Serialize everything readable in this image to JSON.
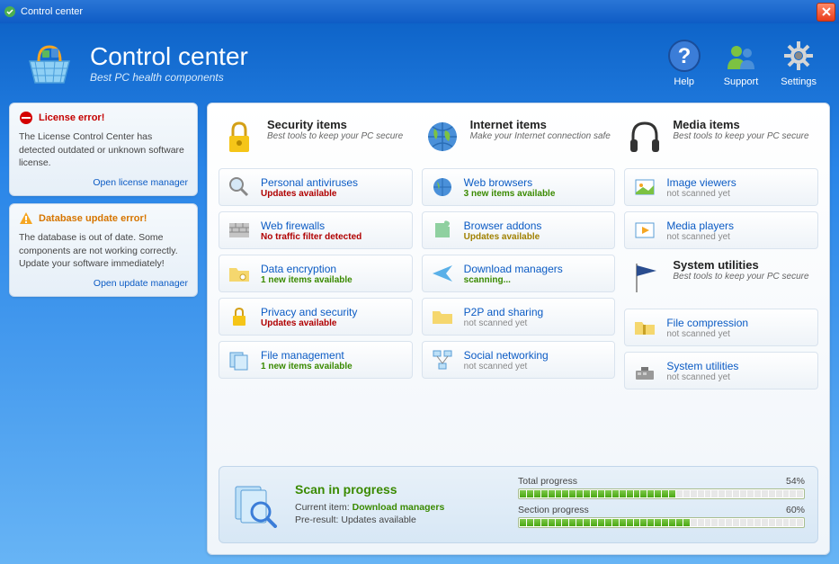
{
  "window": {
    "title": "Control center"
  },
  "header": {
    "title": "Control center",
    "subtitle": "Best PC health components",
    "buttons": {
      "help": "Help",
      "support": "Support",
      "settings": "Settings"
    }
  },
  "sidebar": {
    "alerts": [
      {
        "title": "License error!",
        "body": "The License Control Center has detected outdated or unknown software license.",
        "link": "Open license manager"
      },
      {
        "title": "Database update error!",
        "body": "The database is out of date. Some components are not working correctly. Update your software immediately!",
        "link": "Open update manager"
      }
    ]
  },
  "columns": [
    {
      "title": "Security items",
      "subtitle": "Best tools to keep your PC secure",
      "items": [
        {
          "name": "Personal antiviruses",
          "status": "Updates available",
          "statusClass": "status-red"
        },
        {
          "name": "Web firewalls",
          "status": "No traffic filter detected",
          "statusClass": "status-red"
        },
        {
          "name": "Data encryption",
          "status": "1 new items available",
          "statusClass": "status-green"
        },
        {
          "name": "Privacy and security",
          "status": "Updates available",
          "statusClass": "status-red"
        },
        {
          "name": "File management",
          "status": "1 new items available",
          "statusClass": "status-green"
        }
      ]
    },
    {
      "title": "Internet items",
      "subtitle": "Make your Internet connection safe",
      "items": [
        {
          "name": "Web browsers",
          "status": "3 new items available",
          "statusClass": "status-green"
        },
        {
          "name": "Browser addons",
          "status": "Updates available",
          "statusClass": "status-olive"
        },
        {
          "name": "Download managers",
          "status": "scanning...",
          "statusClass": "status-green"
        },
        {
          "name": "P2P and sharing",
          "status": "not scanned yet",
          "statusClass": "status-gray"
        },
        {
          "name": "Social networking",
          "status": "not scanned yet",
          "statusClass": "status-gray"
        }
      ]
    },
    {
      "title": "Media items",
      "subtitle": "Best tools to keep your PC secure",
      "items": [
        {
          "name": "Image viewers",
          "status": "not scanned yet",
          "statusClass": "status-gray"
        },
        {
          "name": "Media players",
          "status": "not scanned yet",
          "statusClass": "status-gray"
        }
      ],
      "section2": {
        "title": "System utilities",
        "subtitle": "Best tools to keep your PC secure",
        "items": [
          {
            "name": "File compression",
            "status": "not scanned yet",
            "statusClass": "status-gray"
          },
          {
            "name": "System utilities",
            "status": "not scanned yet",
            "statusClass": "status-gray"
          }
        ]
      }
    }
  ],
  "scan": {
    "title": "Scan in progress",
    "currentLabel": "Current item:",
    "currentValue": "Download managers",
    "preLabel": "Pre-result:",
    "preValue": "Updates available",
    "totalLabel": "Total progress",
    "totalPercent": "54%",
    "totalValue": 54,
    "sectionLabel": "Section progress",
    "sectionPercent": "60%",
    "sectionValue": 60
  }
}
